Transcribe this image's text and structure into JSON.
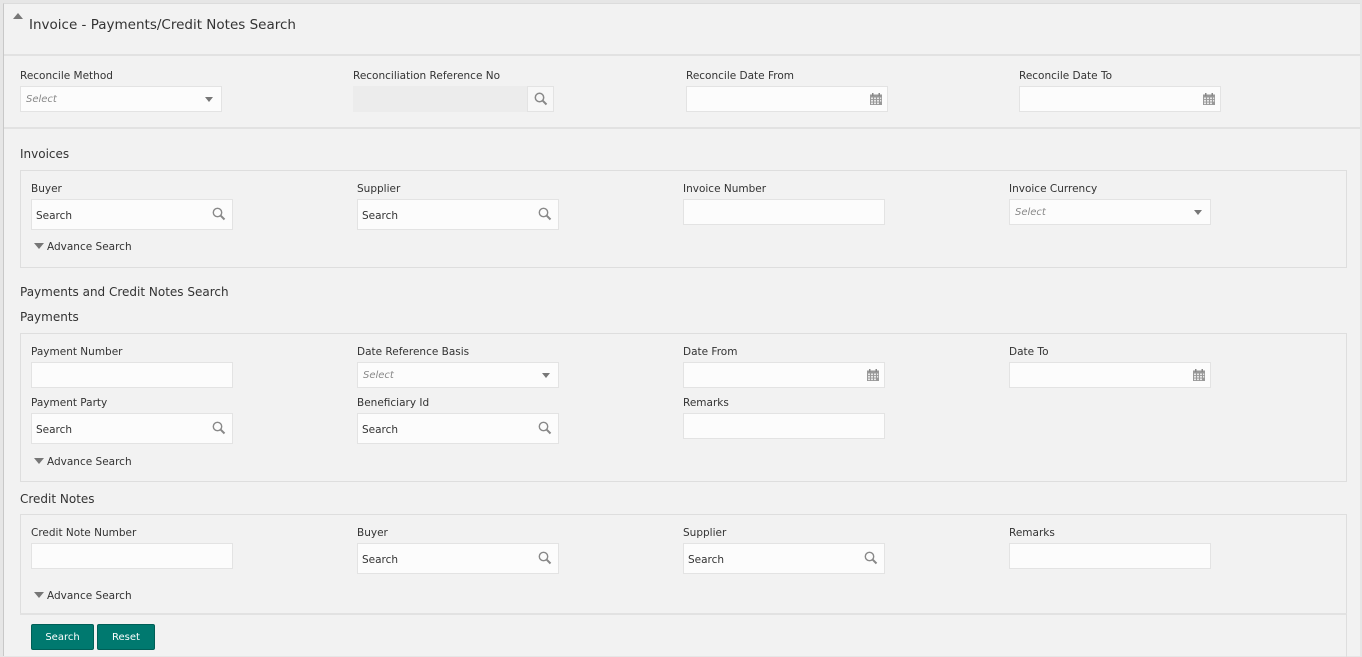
{
  "header": {
    "title": "Invoice - Payments/Credit Notes Search",
    "collapse_icon": "caret-up-icon"
  },
  "reconcile": {
    "method": {
      "label": "Reconcile Method",
      "placeholder": "Select"
    },
    "reference": {
      "label": "Reconciliation Reference No",
      "value": ""
    },
    "date_from": {
      "label": "Reconcile Date From",
      "value": ""
    },
    "date_to": {
      "label": "Reconcile Date To",
      "value": ""
    }
  },
  "invoices": {
    "title": "Invoices",
    "buyer": {
      "label": "Buyer",
      "value": "Search"
    },
    "supplier": {
      "label": "Supplier",
      "value": "Search"
    },
    "invoice_number": {
      "label": "Invoice Number",
      "value": ""
    },
    "currency": {
      "label": "Invoice Currency",
      "placeholder": "Select"
    },
    "advance_search": "Advance Search"
  },
  "payments_credit": {
    "title": "Payments and Credit Notes Search"
  },
  "payments": {
    "title": "Payments",
    "payment_number": {
      "label": "Payment Number",
      "value": ""
    },
    "date_reference_basis": {
      "label": "Date Reference Basis",
      "placeholder": "Select"
    },
    "date_from": {
      "label": "Date From",
      "value": ""
    },
    "date_to": {
      "label": "Date To",
      "value": ""
    },
    "payment_party": {
      "label": "Payment Party",
      "value": "Search"
    },
    "beneficiary_id": {
      "label": "Beneficiary Id",
      "value": "Search"
    },
    "remarks": {
      "label": "Remarks",
      "value": ""
    },
    "advance_search": "Advance Search"
  },
  "credit_notes": {
    "title": "Credit Notes",
    "credit_note_number": {
      "label": "Credit Note Number",
      "value": ""
    },
    "buyer": {
      "label": "Buyer",
      "value": "Search"
    },
    "supplier": {
      "label": "Supplier",
      "value": "Search"
    },
    "remarks": {
      "label": "Remarks",
      "value": ""
    },
    "advance_search": "Advance Search"
  },
  "actions": {
    "search": "Search",
    "reset": "Reset"
  },
  "colors": {
    "primary_button": "#00796f",
    "background": "#f2f2f2"
  }
}
